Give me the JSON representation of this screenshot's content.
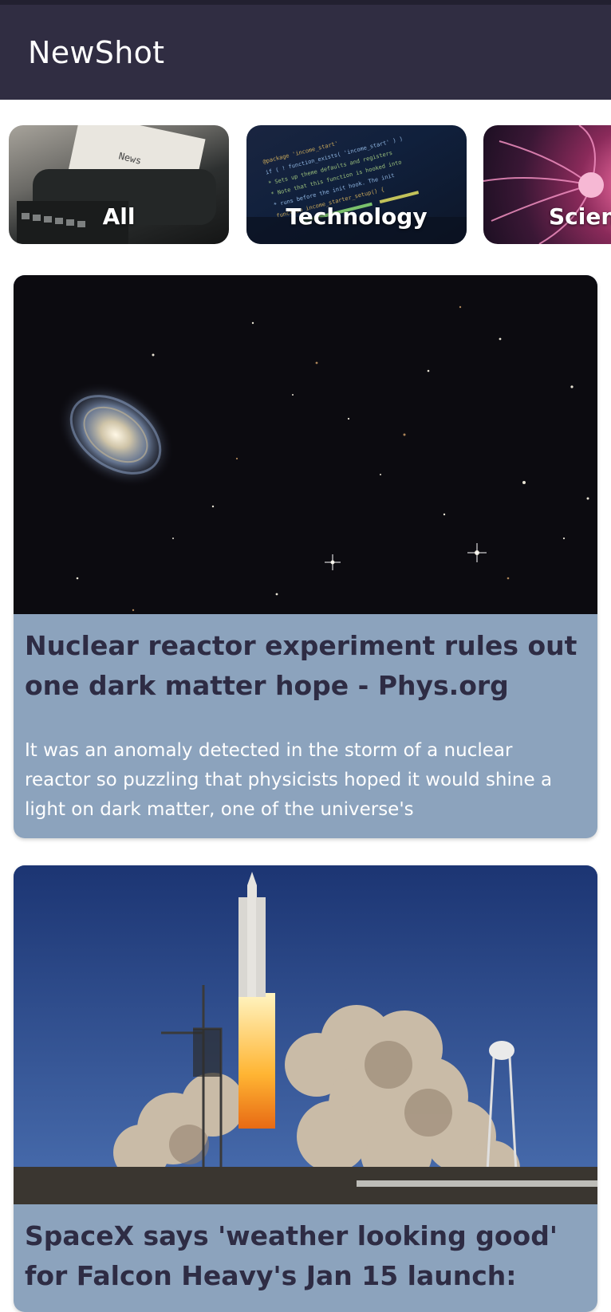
{
  "app": {
    "title": "NewShot"
  },
  "categories": [
    {
      "label": "All"
    },
    {
      "label": "Technology"
    },
    {
      "label": "Scien"
    }
  ],
  "articles": [
    {
      "title": "Nuclear reactor experiment rules out one dark matter hope - Phys.org",
      "description": "It was an anomaly detected in the storm of a nuclear reactor so puzzling that physicists hoped it would shine a light on dark matter, one of the universe's"
    },
    {
      "title": "SpaceX says 'weather looking good' for Falcon Heavy's Jan 15 launch:",
      "description": ""
    }
  ],
  "colors": {
    "app_bar": "#302d42",
    "card_background": "#8ca3bd",
    "card_title": "#2e2c44",
    "card_description": "#ffffff"
  }
}
